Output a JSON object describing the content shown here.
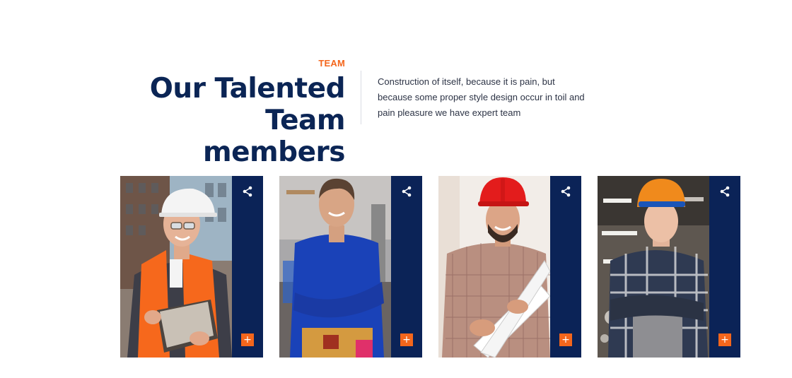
{
  "section": {
    "eyebrow": "TEAM",
    "title_line1": "Our Talented",
    "title_line2": "Team members",
    "intro_line1": "Construction of itself, because it is pain, but",
    "intro_line2": "because some proper style design occur in toil and",
    "intro_line3": "pain pleasure we have expert team"
  },
  "team": [
    {
      "photo": "engineer-white-helmet-tablet",
      "share_icon": "share-icon",
      "plus_label": "+"
    },
    {
      "photo": "worker-blue-overalls",
      "share_icon": "share-icon",
      "plus_label": "+"
    },
    {
      "photo": "worker-red-helmet-blueprints",
      "share_icon": "share-icon",
      "plus_label": "+"
    },
    {
      "photo": "worker-orange-helmet-plaid-shirt",
      "share_icon": "share-icon",
      "plus_label": "+"
    }
  ],
  "colors": {
    "accent": "#f4661c",
    "navy": "#0b2357",
    "title": "#0b2555"
  }
}
